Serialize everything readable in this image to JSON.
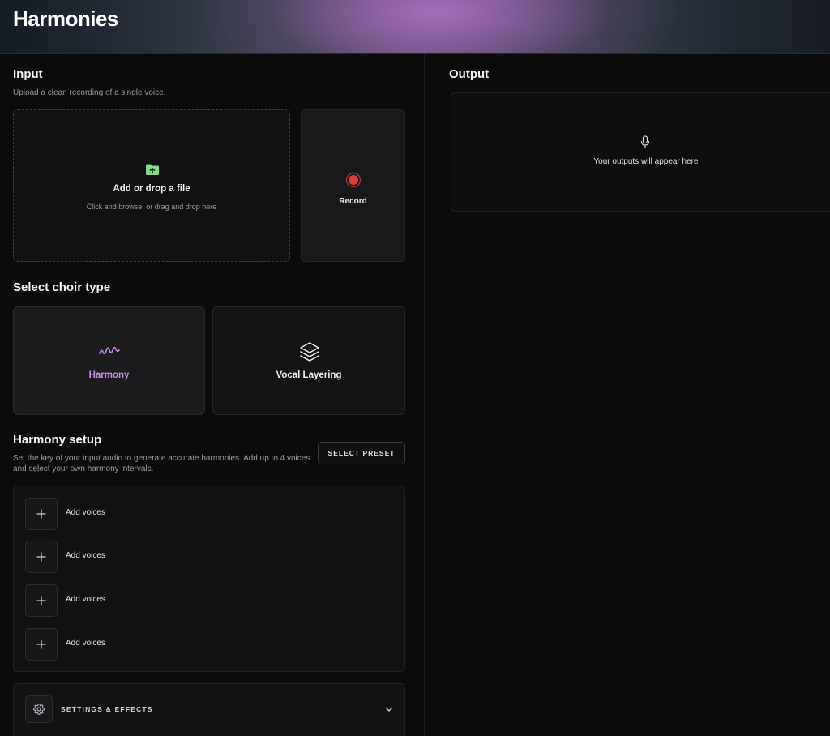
{
  "header": {
    "title": "Harmonies"
  },
  "input": {
    "title": "Input",
    "subtitle": "Upload a clean recording of a single voice.",
    "dropzone": {
      "title": "Add or drop a file",
      "subtitle": "Click and browse, or drag and drop here",
      "icon": "folder-upload-icon"
    },
    "record": {
      "label": "Record",
      "icon": "record-icon"
    }
  },
  "choir": {
    "title": "Select choir type",
    "options": [
      {
        "label": "Harmony",
        "icon": "wave-icon",
        "selected": true
      },
      {
        "label": "Vocal Layering",
        "icon": "layers-icon",
        "selected": false
      }
    ]
  },
  "harmony_setup": {
    "title": "Harmony setup",
    "description": "Set the key of your input audio to generate accurate harmonies. Add up to 4 voices and select your own harmony intervals.",
    "preset_button": "SELECT PRESET",
    "voices": [
      {
        "label": "Add voices"
      },
      {
        "label": "Add voices"
      },
      {
        "label": "Add voices"
      },
      {
        "label": "Add voices"
      }
    ]
  },
  "settings": {
    "label": "SETTINGS & EFFECTS",
    "icon": "gear-icon"
  },
  "output": {
    "title": "Output",
    "empty_text": "Your outputs will appear here",
    "icon": "microphone-icon"
  },
  "colors": {
    "accent_purple": "#c98ee6",
    "upload_green": "#7fe08a",
    "record_red": "#e03c3c",
    "background": "#0b0b0c"
  }
}
